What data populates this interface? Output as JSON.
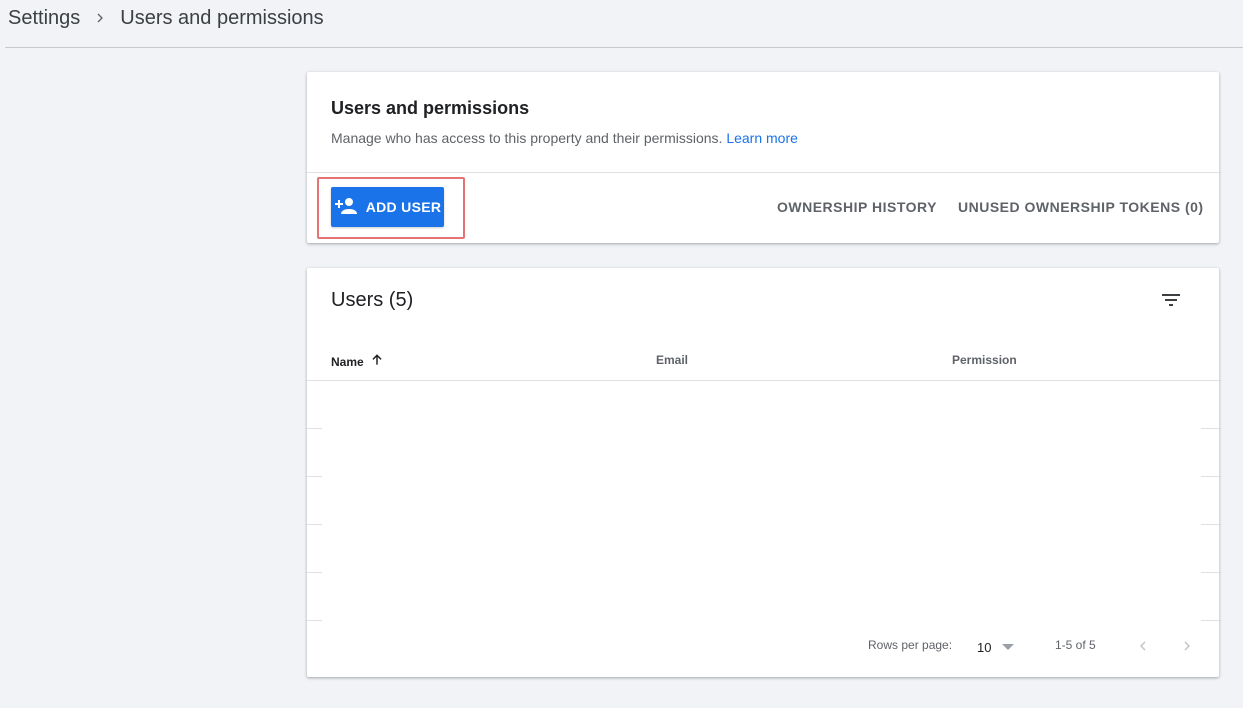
{
  "breadcrumb": {
    "root": "Settings",
    "current": "Users and permissions"
  },
  "permissions_card": {
    "title": "Users and permissions",
    "description": "Manage who has access to this property and their permissions.",
    "learn_more": "Learn more",
    "add_user_label": "ADD USER",
    "ownership_history_label": "OWNERSHIP HISTORY",
    "unused_tokens_label": "UNUSED OWNERSHIP TOKENS (0)"
  },
  "users_card": {
    "title": "Users (5)",
    "columns": {
      "name": "Name",
      "email": "Email",
      "permission": "Permission"
    },
    "footer": {
      "rows_per_page_label": "Rows per page:",
      "rows_per_page_value": "10",
      "page_range": "1-5 of 5"
    }
  },
  "colors": {
    "accent": "#1a73e8",
    "highlight_border": "#e57373",
    "background": "#f1f3f7"
  }
}
